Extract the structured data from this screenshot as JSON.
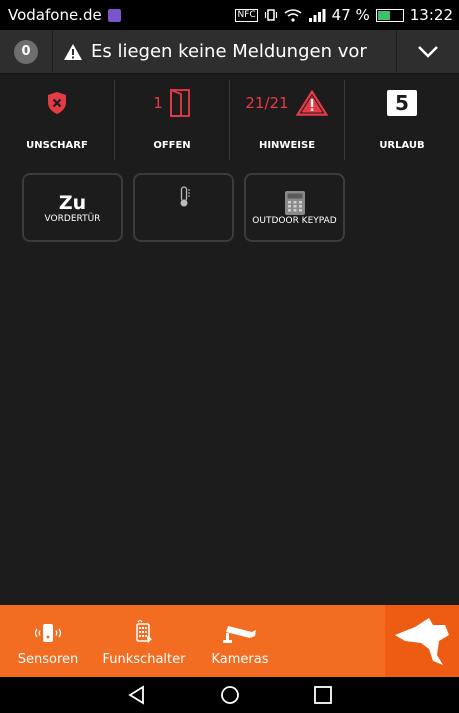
{
  "statusbar": {
    "carrier": "Vodafone.de",
    "nfc": "NFC",
    "battery_pct": "47 %",
    "battery_level": 0.47,
    "time": "13:22"
  },
  "notification": {
    "count": "0",
    "message": "Es liegen keine Meldungen vor"
  },
  "status": [
    {
      "label": "UNSCHARF"
    },
    {
      "label": "OFFEN",
      "value": "1"
    },
    {
      "label": "HINWEISE",
      "value": "21/21"
    },
    {
      "label": "URLAUB",
      "value": "5"
    }
  ],
  "tiles": [
    {
      "big": "Zu",
      "small": "VORDERTÜR"
    },
    {
      "big": "",
      "small": ""
    },
    {
      "big": "",
      "small": "OUTDOOR KEYPAD"
    }
  ],
  "bottom": {
    "items": [
      {
        "label": "Sensoren"
      },
      {
        "label": "Funkschalter"
      },
      {
        "label": "Kameras"
      }
    ]
  },
  "colors": {
    "accent": "#f26d21",
    "alert": "#e53b47",
    "background": "#1c1c1c"
  }
}
